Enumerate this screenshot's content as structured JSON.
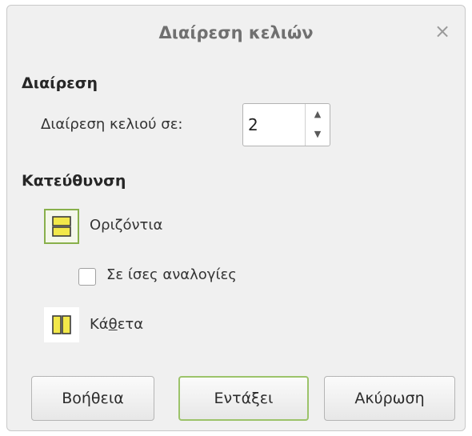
{
  "dialog": {
    "title": "Διαίρεση κελιών",
    "close_glyph": "×"
  },
  "split_section": {
    "heading": "Διαίρεση",
    "split_into_label": "Διαίρεση κελιού σε:",
    "split_value": "2"
  },
  "direction_section": {
    "heading": "Κατεύθυνση",
    "horizontal": {
      "label": "Οριζόντια",
      "selected": true,
      "icon": "horizontal-split-icon"
    },
    "equal_proportions": {
      "label": "Σε ίσες αναλογίες",
      "checked": false
    },
    "vertical": {
      "label_pre": "Κά",
      "label_mnemonic": "θ",
      "label_post": "ετα",
      "selected": false,
      "icon": "vertical-split-icon"
    }
  },
  "buttons": {
    "help": "Βοήθεια",
    "ok": "Εντάξει",
    "cancel": "Ακύρωση"
  },
  "colors": {
    "accent_green": "#88b04b",
    "icon_yellow": "#f2e84a",
    "dialog_bg": "#f0f0f0"
  }
}
